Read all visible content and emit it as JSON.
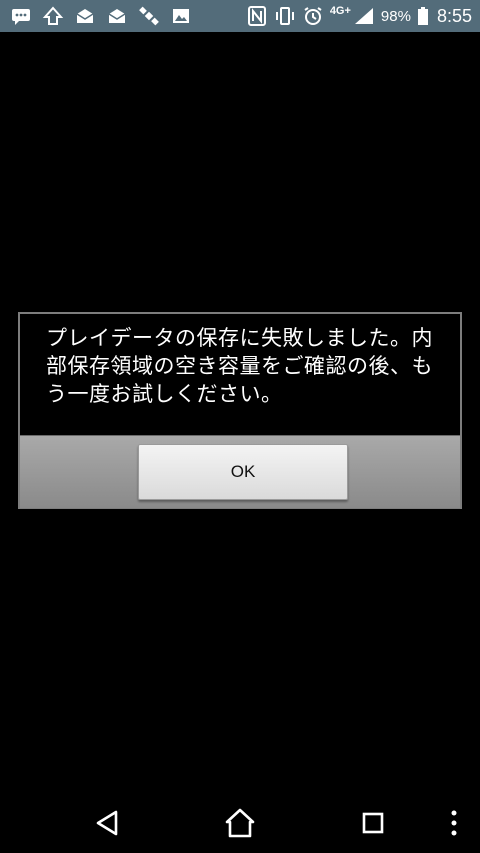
{
  "status_bar": {
    "icons_left": [
      "messages-icon",
      "notification-icon",
      "mail-icon",
      "mail-icon",
      "satellite-icon",
      "image-icon"
    ],
    "icons_right": [
      "nfc-icon",
      "vibrate-icon",
      "alarm-icon"
    ],
    "network": "4G+",
    "battery_percent": "98%",
    "time": "8:55"
  },
  "dialog": {
    "message": "プレイデータの保存に失敗しました。内部保存領域の空き容量をご確認の後、もう一度お試しください。",
    "ok_label": "OK"
  },
  "nav_bar": {
    "buttons": [
      "back-icon",
      "home-icon",
      "recents-icon",
      "more-icon"
    ]
  }
}
